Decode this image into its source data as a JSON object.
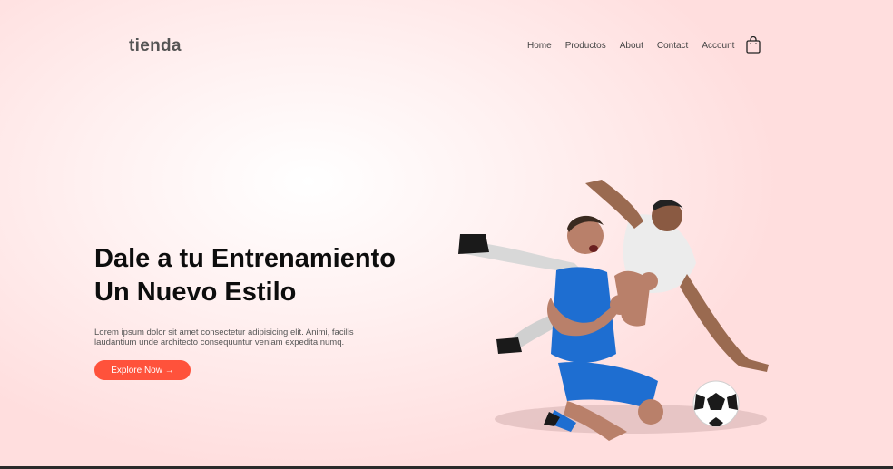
{
  "brand": {
    "logo": "tienda",
    "accent": "#ff523b"
  },
  "nav": {
    "items": [
      {
        "label": "Home"
      },
      {
        "label": "Productos"
      },
      {
        "label": "About"
      },
      {
        "label": "Contact"
      },
      {
        "label": "Account"
      }
    ],
    "cart_icon": "shopping-bag-icon"
  },
  "hero": {
    "title_line1": "Dale a tu Entrenamiento",
    "title_line2": "Un Nuevo Estilo",
    "description_line1": "Lorem ipsum dolor sit amet consectetur adipisicing elit. Animi, facilis",
    "description_line2": "laudantium unde architecto consequuntur veniam expedita numq.",
    "cta_label": "Explore Now →"
  },
  "image": {
    "subject": "soccer-players-image"
  }
}
